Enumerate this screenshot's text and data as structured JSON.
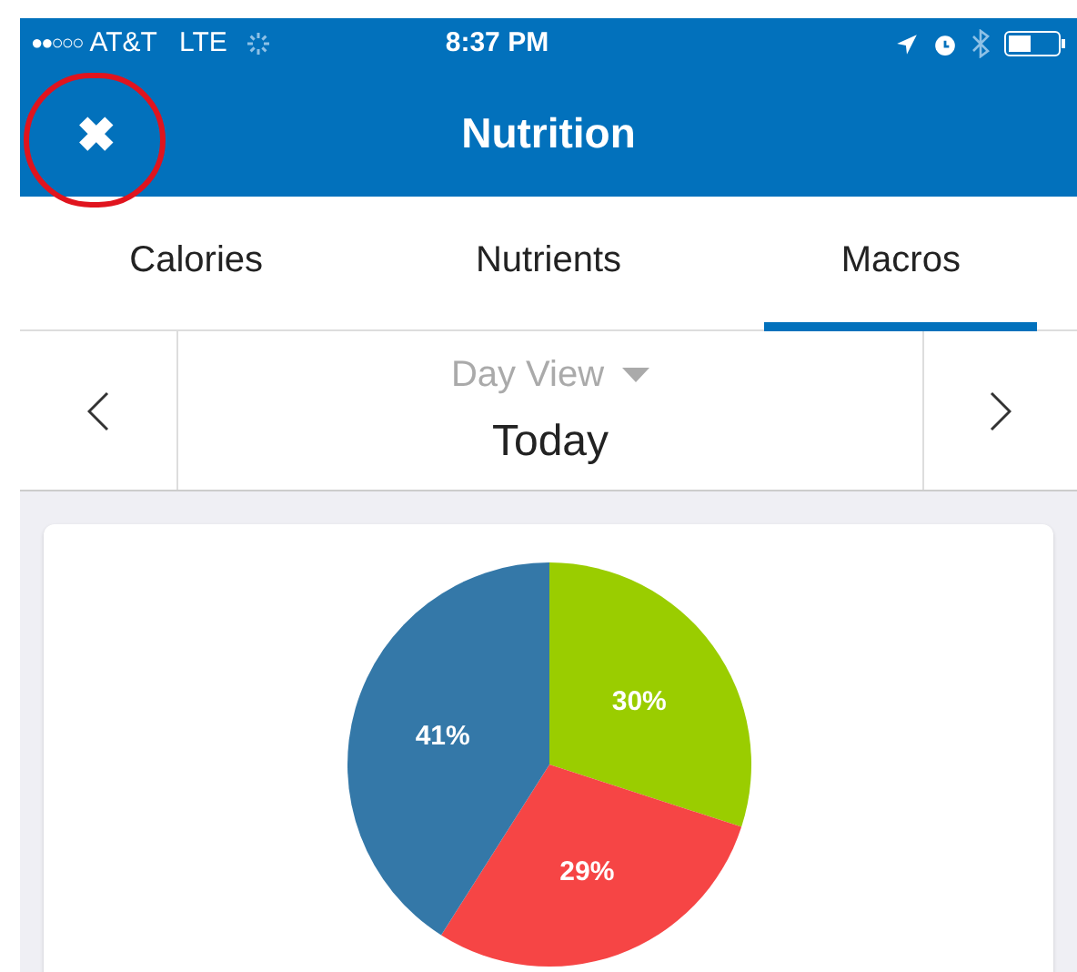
{
  "status_bar": {
    "signal_dots": "●●○○○",
    "carrier": "AT&T",
    "network": "LTE",
    "time": "8:37 PM"
  },
  "nav_bar": {
    "title": "Nutrition",
    "close_icon": "✖",
    "close_annotated": true
  },
  "tabs": [
    {
      "label": "Calories",
      "selected": false
    },
    {
      "label": "Nutrients",
      "selected": false
    },
    {
      "label": "Macros",
      "selected": true
    }
  ],
  "date_nav": {
    "view": "Day View",
    "date": "Today"
  },
  "macros_card": {
    "chart_data": {
      "type": "pie",
      "values": [
        30,
        29,
        41
      ],
      "colors": [
        "#9acd00",
        "#f64545",
        "#3478a8"
      ],
      "value_labels": [
        "30%",
        "29%",
        "41%"
      ]
    }
  }
}
